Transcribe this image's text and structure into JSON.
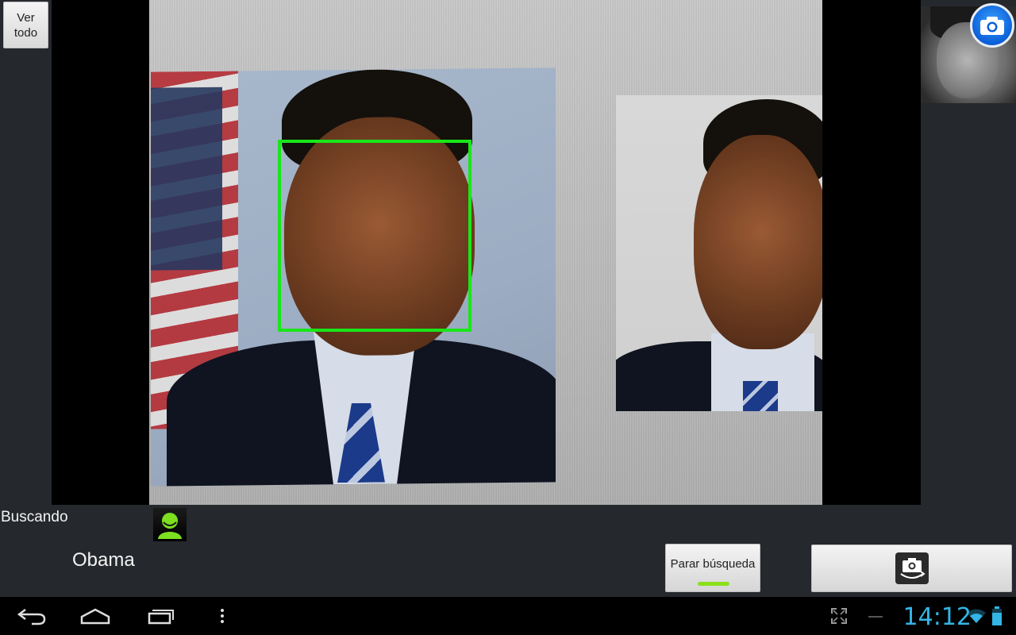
{
  "toolbar": {
    "ver_todo_label": "Ver todo"
  },
  "status": {
    "searching_label": "Buscando",
    "recognized_name": "Obama"
  },
  "actions": {
    "stop_search_label": "Parar búsqueda"
  },
  "statusbar": {
    "time": "14:12"
  },
  "colors": {
    "face_box": "#19e619",
    "clock": "#33b5e5",
    "indicator": "#8be01a",
    "camera_fab": "#0b5fd8"
  },
  "icons": [
    "camera-icon",
    "person-icon",
    "switch-camera-icon",
    "back-icon",
    "home-icon",
    "recent-apps-icon",
    "menu-icon",
    "fullscreen-icon",
    "wifi-icon",
    "battery-icon"
  ]
}
